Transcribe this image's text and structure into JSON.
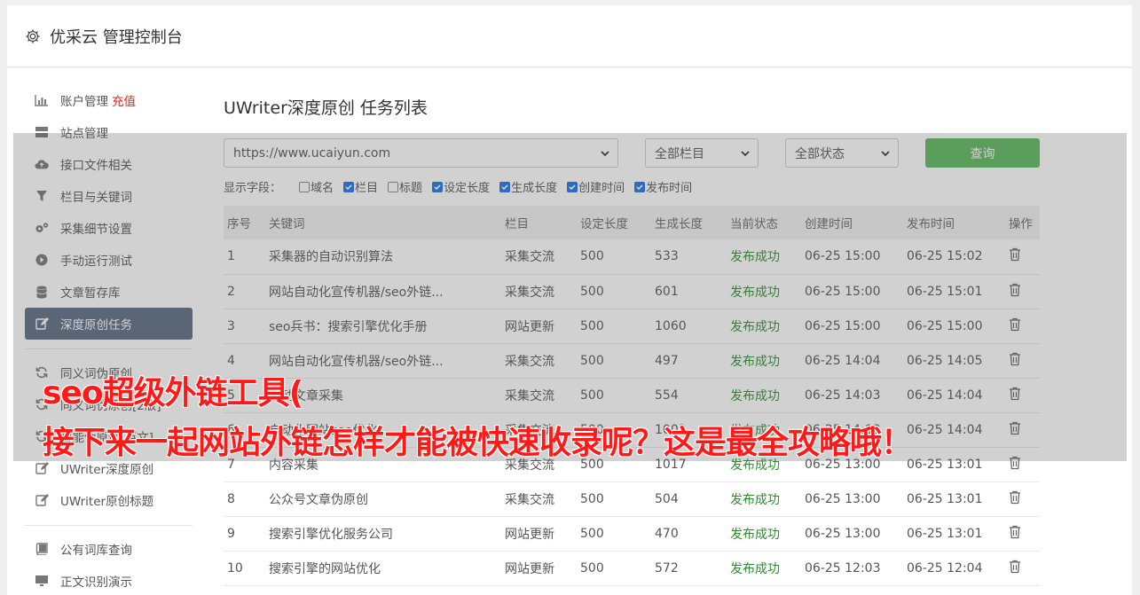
{
  "header": {
    "title": "优采云 管理控制台",
    "icon": "gear-icon"
  },
  "sidebar": {
    "items": [
      {
        "label": "账户管理",
        "badge": "充值",
        "icon": "bar-chart-icon"
      },
      {
        "label": "站点管理",
        "icon": "server-icon"
      },
      {
        "label": "接口文件相关",
        "icon": "cloud-upload-icon"
      },
      {
        "label": "栏目与关键词",
        "icon": "filter-icon"
      },
      {
        "label": "采集细节设置",
        "icon": "cogs-icon"
      },
      {
        "label": "手动运行测试",
        "icon": "play-circle-icon"
      },
      {
        "label": "文章暂存库",
        "icon": "database-icon"
      },
      {
        "label": "深度原创任务",
        "icon": "edit-icon",
        "active": true
      },
      {
        "label": "同义词伪原创",
        "icon": "refresh-icon"
      },
      {
        "label": "同义词伪原创[2版]",
        "icon": "refresh-icon"
      },
      {
        "label": "智能伪原创[英文]",
        "icon": "refresh-icon"
      },
      {
        "label": "UWriter深度原创",
        "icon": "edit-icon"
      },
      {
        "label": "UWriter原创标题",
        "icon": "edit-icon"
      },
      {
        "label": "公有词库查询",
        "icon": "book-icon"
      },
      {
        "label": "正文识别演示",
        "icon": "monitor-icon"
      }
    ]
  },
  "main": {
    "title": "UWriter深度原创 任务列表",
    "filters": {
      "site": "https://www.ucaiyun.com",
      "column": "全部栏目",
      "status": "全部状态",
      "query_label": "查询"
    },
    "fields": {
      "label": "显示字段：",
      "options": [
        {
          "label": "域名",
          "checked": false
        },
        {
          "label": "栏目",
          "checked": true
        },
        {
          "label": "标题",
          "checked": false
        },
        {
          "label": "设定长度",
          "checked": true
        },
        {
          "label": "生成长度",
          "checked": true
        },
        {
          "label": "创建时间",
          "checked": true
        },
        {
          "label": "发布时间",
          "checked": true
        }
      ]
    },
    "table": {
      "headers": [
        "序号",
        "关键词",
        "栏目",
        "设定长度",
        "生成长度",
        "当前状态",
        "创建时间",
        "发布时间",
        "操作"
      ],
      "rows": [
        [
          "1",
          "采集器的自动识别算法",
          "采集交流",
          "500",
          "533",
          "发布成功",
          "06-25 15:00",
          "06-25 15:02"
        ],
        [
          "2",
          "网站自动化宣传机器/seo外链...",
          "采集交流",
          "500",
          "601",
          "发布成功",
          "06-25 15:00",
          "06-25 15:01"
        ],
        [
          "3",
          "seo兵书：搜索引擎优化手册",
          "网站更新",
          "500",
          "1060",
          "发布成功",
          "06-25 15:00",
          "06-25 15:00"
        ],
        [
          "4",
          "网站自动化宣传机器/seo外链...",
          "采集交流",
          "500",
          "497",
          "发布成功",
          "06-25 14:04",
          "06-25 14:05"
        ],
        [
          "5",
          "自动文章采集",
          "采集交流",
          "500",
          "554",
          "发布成功",
          "06-25 14:03",
          "06-25 14:04"
        ],
        [
          "6",
          "自动化网站seo优化...",
          "采集交流",
          "500",
          "1002",
          "发布成功",
          "06-25 14:03",
          "06-25 14:04"
        ],
        [
          "7",
          "内容采集",
          "采集交流",
          "500",
          "1017",
          "发布成功",
          "06-25 13:00",
          "06-25 13:01"
        ],
        [
          "8",
          "公众号文章伪原创",
          "采集交流",
          "500",
          "504",
          "发布成功",
          "06-25 13:00",
          "06-25 13:01"
        ],
        [
          "9",
          "搜索引擎优化服务公司",
          "网站更新",
          "500",
          "470",
          "发布成功",
          "06-25 13:00",
          "06-25 13:01"
        ],
        [
          "10",
          "搜索引擎的网站优化",
          "网站更新",
          "500",
          "572",
          "发布成功",
          "06-25 12:03",
          "06-25 12:04"
        ]
      ]
    }
  },
  "banner": {
    "line1": "seo超级外链工具(",
    "line2": "接下来一起网站外链怎样才能被快速收录呢？这是最全攻略哦！"
  },
  "colors": {
    "accent": "#5cb85c",
    "active_nav": "#5a6a80",
    "status_ok": "#2e8b2e",
    "banner": "#ff1a1a",
    "recharge": "#e0241b"
  }
}
